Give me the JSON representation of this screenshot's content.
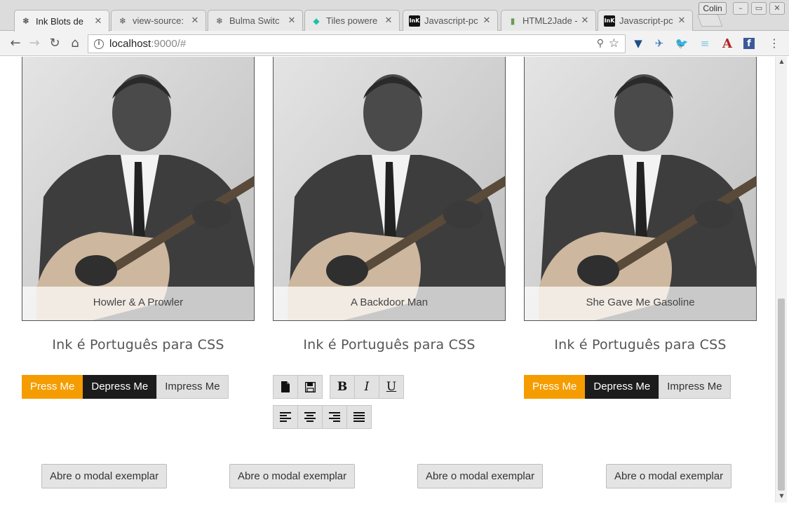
{
  "browser": {
    "tabs": [
      {
        "title": "Ink Blots de",
        "icon": "snowflake-icon",
        "active": true
      },
      {
        "title": "view-source:",
        "icon": "snowflake-icon",
        "active": false
      },
      {
        "title": "Bulma Switc",
        "icon": "snowflake-icon",
        "active": false
      },
      {
        "title": "Tiles powere",
        "icon": "tiles-icon",
        "active": false
      },
      {
        "title": "Javascript-pc",
        "icon": "ink-logo-icon",
        "active": false
      },
      {
        "title": "HTML2Jade -",
        "icon": "jade-icon",
        "active": false
      },
      {
        "title": "Javascript-pc",
        "icon": "ink-logo-icon",
        "active": false
      }
    ],
    "profile_name": "Colin",
    "address": {
      "host": "localhost",
      "rest": ":9000/#"
    },
    "ink_favicon_text": "InK"
  },
  "cards": [
    {
      "caption": "Howler & A Prowler"
    },
    {
      "caption": "A Backdoor Man"
    },
    {
      "caption": "She Gave Me Gasoline"
    }
  ],
  "headings": [
    "Ink é Português para CSS",
    "Ink é Português para CSS",
    "Ink é Português para CSS"
  ],
  "group_left": {
    "press": "Press Me",
    "depress": "Depress Me",
    "impress": "Impress Me"
  },
  "group_right": {
    "press": "Press Me",
    "depress": "Depress Me",
    "impress": "Impress Me"
  },
  "editor": {
    "file_icons": [
      "new-file-icon",
      "save-icon"
    ],
    "format": {
      "bold": "B",
      "italic": "I",
      "underline": "U"
    },
    "align_icons": [
      "align-left-icon",
      "align-center-icon",
      "align-right-icon",
      "align-justify-icon"
    ]
  },
  "modal_buttons": [
    "Abre o modal exemplar",
    "Abre o modal exemplar",
    "Abre o modal exemplar",
    "Abre o modal exemplar"
  ],
  "colors": {
    "accent_orange": "#f59d00",
    "dark": "#1c1c1c",
    "button_grey": "#e2e2e2"
  }
}
